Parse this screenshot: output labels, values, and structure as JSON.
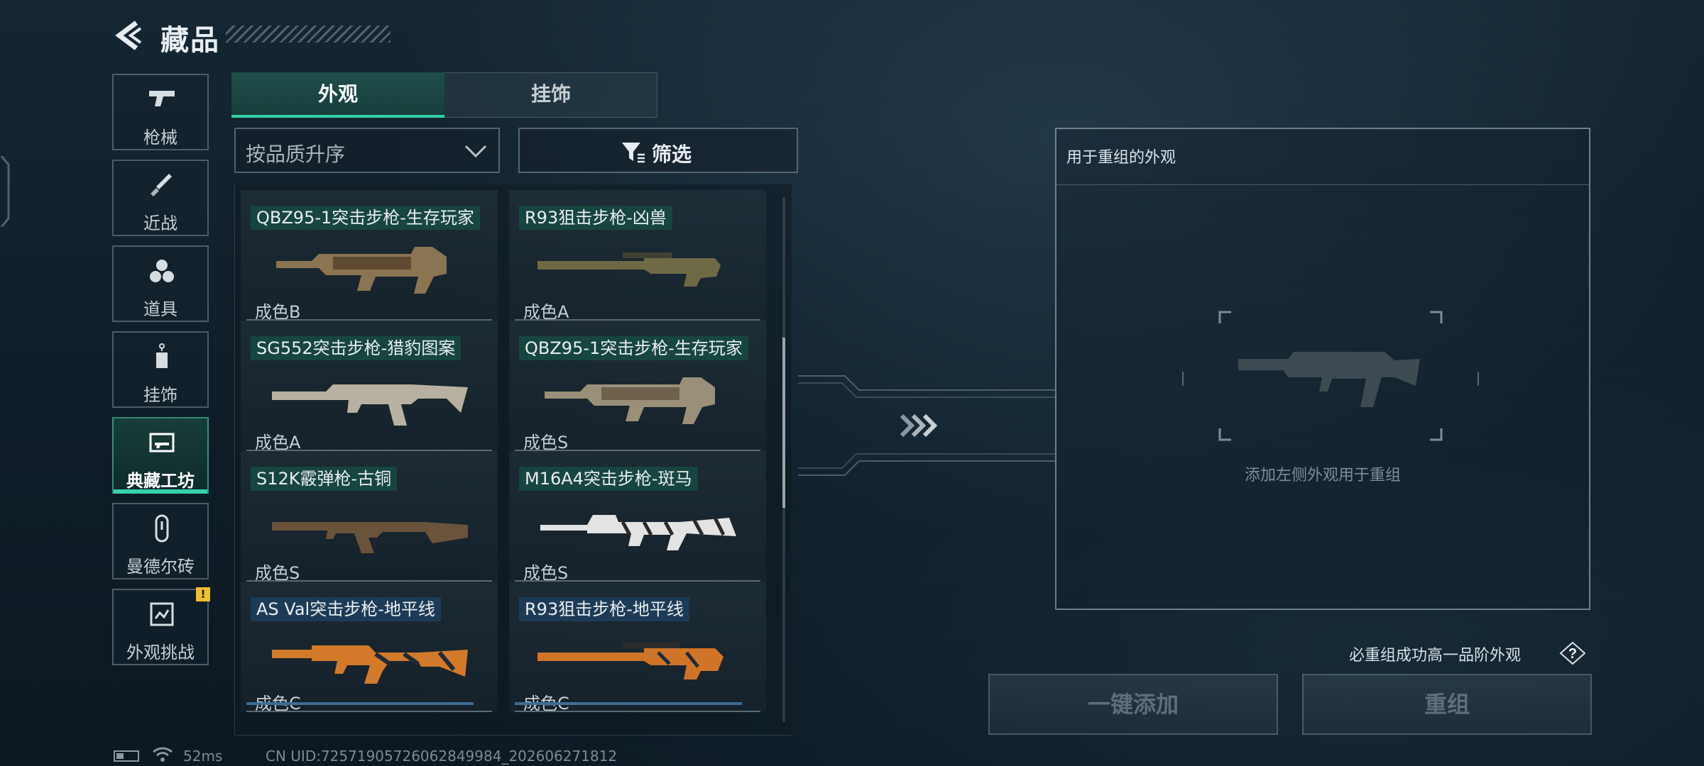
{
  "header": {
    "title": "藏品"
  },
  "sidebar": {
    "items": [
      {
        "label": "枪械",
        "icon": "pistol-icon",
        "active": false
      },
      {
        "label": "近战",
        "icon": "knife-icon",
        "active": false
      },
      {
        "label": "道具",
        "icon": "grenades-icon",
        "active": false
      },
      {
        "label": "挂饰",
        "icon": "charm-tag-icon",
        "active": false
      },
      {
        "label": "典藏工坊",
        "icon": "workshop-icon",
        "active": true
      },
      {
        "label": "曼德尔砖",
        "icon": "mandel-brick-icon",
        "active": false
      },
      {
        "label": "外观挑战",
        "icon": "challenge-icon",
        "active": false,
        "badge": "!"
      }
    ]
  },
  "tabs": [
    {
      "label": "外观",
      "active": true
    },
    {
      "label": "挂饰",
      "active": false
    }
  ],
  "sort": {
    "label": "按品质升序"
  },
  "filter": {
    "label": "筛选"
  },
  "skins": [
    {
      "name": "QBZ95-1突击步枪-生存玩家",
      "grade": "成色B",
      "tag_color": "green"
    },
    {
      "name": "R93狙击步枪-凶兽",
      "grade": "成色A",
      "tag_color": "green"
    },
    {
      "name": "SG552突击步枪-猎豹图案",
      "grade": "成色A",
      "tag_color": "green"
    },
    {
      "name": "QBZ95-1突击步枪-生存玩家",
      "grade": "成色S",
      "tag_color": "green"
    },
    {
      "name": "S12K霰弹枪-古铜",
      "grade": "成色S",
      "tag_color": "green"
    },
    {
      "name": "M16A4突击步枪-斑马",
      "grade": "成色S",
      "tag_color": "green"
    },
    {
      "name": "AS Val突击步枪-地平线",
      "grade": "成色C",
      "tag_color": "blue"
    },
    {
      "name": "R93狙击步枪-地平线",
      "grade": "成色C",
      "tag_color": "blue"
    }
  ],
  "reforge": {
    "heading": "用于重组的外观",
    "hint": "添加左侧外观用于重组",
    "guarantee": "必重组成功高一品阶外观",
    "help": "?",
    "quick_add": "一键添加",
    "reforge_button": "重组"
  },
  "status": {
    "ping": "52ms",
    "uid": "CN UID:7257190572606284998​4_202606271812"
  },
  "colors": {
    "accent": "#35d3a8",
    "green_tag": "#17453f",
    "blue_tag": "#1d3b56",
    "alert": "#f2c02c"
  }
}
